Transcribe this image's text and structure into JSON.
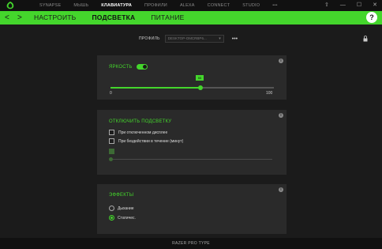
{
  "topbar": {
    "nav": [
      "SYNAPSE",
      "МЫШЬ",
      "КЛАВИАТУРА",
      "ПРОФИЛИ",
      "ALEXA",
      "CONNECT",
      "STUDIO"
    ],
    "active": "КЛАВИАТУРА",
    "more": "•••",
    "window_controls": [
      "⇧",
      "—",
      "☐",
      "✕"
    ]
  },
  "subnav": {
    "back": "<",
    "forward": ">",
    "tabs": [
      "НАСТРОИТЬ",
      "ПОДСВЕТКА",
      "ПИТАНИЕ"
    ],
    "active": "ПОДСВЕТКА",
    "help": "?"
  },
  "profile": {
    "label": "ПРОФИЛЬ",
    "value": "DESKTOP-OMCRBP6...",
    "more": "•••"
  },
  "brightness": {
    "title": "ЯРКОСТЬ",
    "enabled": true,
    "value": "55",
    "value_fraction": 0.55,
    "min_label": "0",
    "max_label": "100"
  },
  "disable_lighting": {
    "title": "ОТКЛЮЧИТЬ ПОДСВЕТКУ",
    "options": [
      "При отключенном дисплее",
      "При бездействии в течение (минут)"
    ],
    "checked": [
      false,
      false
    ]
  },
  "effects": {
    "title": "ЭФФЕКТЫ",
    "options": [
      "Дыхание",
      "Статичес."
    ],
    "selected": 1
  },
  "footer": {
    "device": "RAZER PRO TYPE"
  },
  "colors": {
    "accent": "#44d62c",
    "panel": "#2a2a2a",
    "background": "#1b1b1b"
  }
}
